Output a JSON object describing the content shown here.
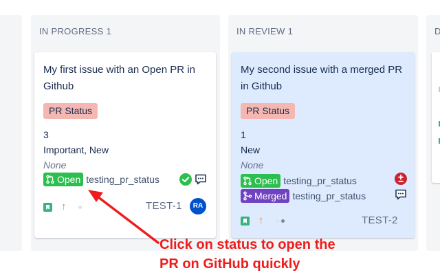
{
  "columns": [
    {
      "id": "in_progress",
      "title": "IN PROGRESS",
      "count": "1"
    },
    {
      "id": "in_review",
      "title": "IN REVIEW",
      "count": "1"
    },
    {
      "id": "done",
      "title": "D"
    }
  ],
  "cards": [
    {
      "title": "My first issue with an Open PR in Github",
      "lozenge": "PR Status",
      "story_points": "3",
      "labels": "Important, New",
      "component": "None",
      "prs": [
        {
          "state": "Open",
          "branch": "testing_pr_status",
          "status_icon": "check-circle-icon",
          "comment_icon": "comment-icon"
        }
      ],
      "type_icon": "story-bookmark-icon",
      "priority_icon": "priority-high-arrow-icon",
      "key": "TEST-1",
      "assignee_initials": "RA"
    },
    {
      "title": "My second issue with a merged PR in Github",
      "lozenge": "PR Status",
      "story_points": "1",
      "labels": "New",
      "component": "None",
      "prs": [
        {
          "state": "Open",
          "branch": "testing_pr_status",
          "status_icon": "diff-plusminus-icon"
        },
        {
          "state": "Merged",
          "branch": "testing_pr_status",
          "comment_icon": "comment-icon"
        }
      ],
      "type_icon": "story-bookmark-icon",
      "priority_icon": "priority-high-arrow-icon",
      "key": "TEST-2"
    }
  ],
  "annotation": {
    "line1": "Click on status to open the",
    "line2": "PR on GitHub quickly"
  },
  "colors": {
    "open_badge": "#2cbe4e",
    "merged_badge": "#6f42c1",
    "lozenge": "#f5b7b1",
    "annotation": "#ee1c1c",
    "selected_card": "#deebff"
  }
}
